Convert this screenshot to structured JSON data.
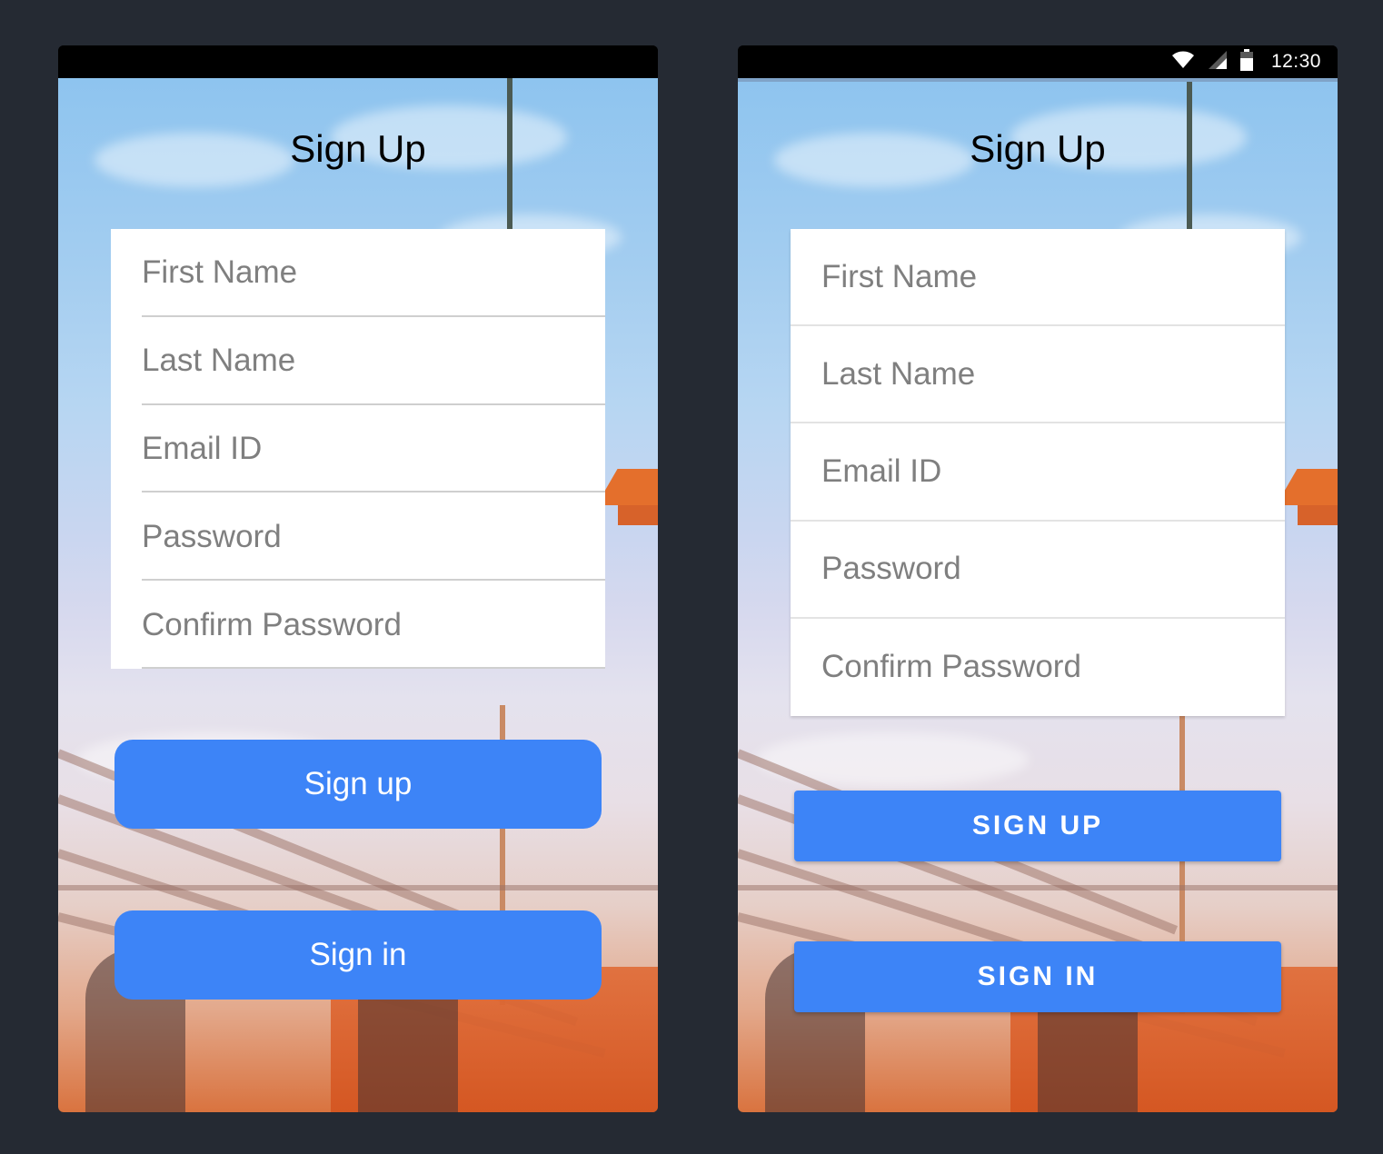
{
  "ios": {
    "title": "Sign Up",
    "fields": [
      {
        "placeholder": "First Name"
      },
      {
        "placeholder": "Last Name"
      },
      {
        "placeholder": "Email ID"
      },
      {
        "placeholder": "Password"
      },
      {
        "placeholder": "Confirm Password"
      }
    ],
    "signup_label": "Sign up",
    "signin_label": "Sign in"
  },
  "android": {
    "status_time": "12:30",
    "title": "Sign Up",
    "fields": [
      {
        "placeholder": "First Name"
      },
      {
        "placeholder": "Last Name"
      },
      {
        "placeholder": "Email ID"
      },
      {
        "placeholder": "Password"
      },
      {
        "placeholder": "Confirm Password"
      }
    ],
    "signup_label": "SIGN UP",
    "signin_label": "SIGN IN"
  },
  "colors": {
    "page_background": "#252a33",
    "button": "#3d84f7",
    "button_text": "#ffffff",
    "placeholder": "#7f7f7f"
  },
  "icons": [
    "wifi-icon",
    "cell-signal-icon",
    "battery-icon"
  ]
}
